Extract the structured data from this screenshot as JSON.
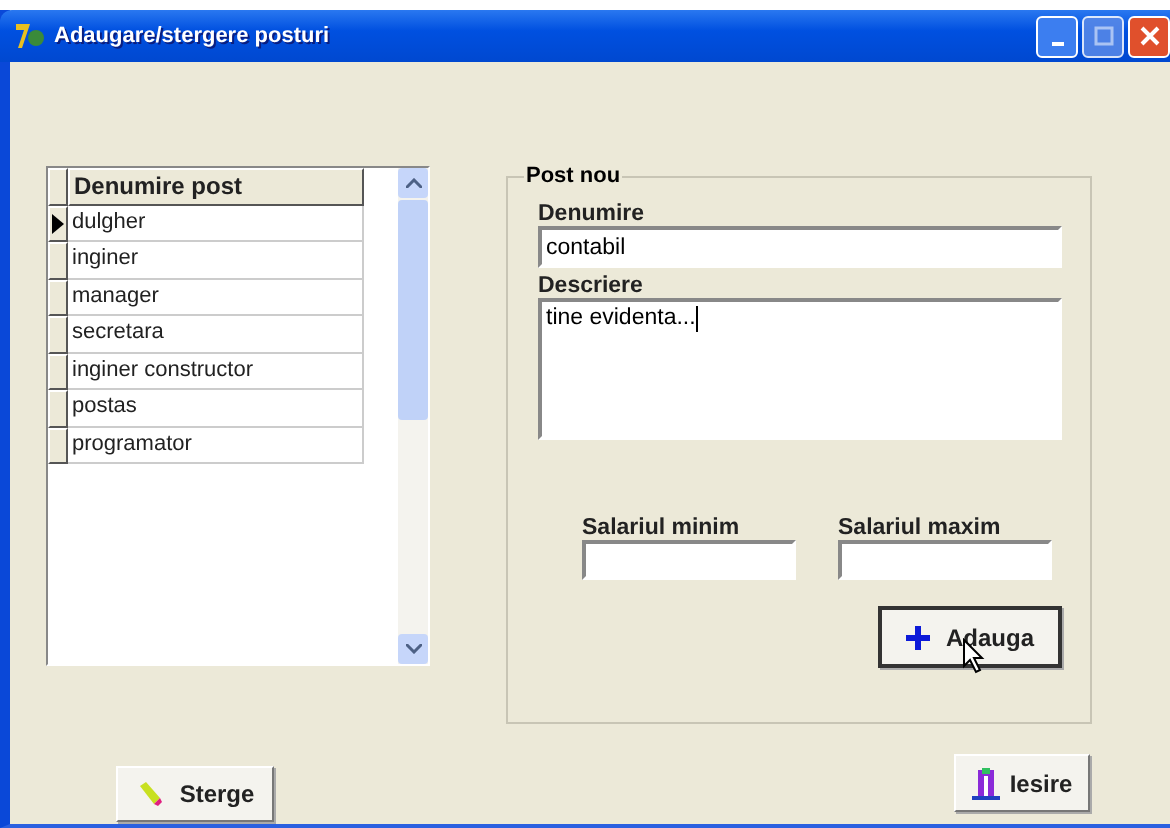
{
  "window": {
    "title": "Adaugare/stergere posturi"
  },
  "grid": {
    "column": "Denumire post",
    "rows": [
      {
        "name": "dulgher",
        "selected": true
      },
      {
        "name": "inginer",
        "selected": false
      },
      {
        "name": "manager",
        "selected": false
      },
      {
        "name": "secretara",
        "selected": false
      },
      {
        "name": "inginer constructor",
        "selected": false
      },
      {
        "name": "postas",
        "selected": false
      },
      {
        "name": "programator",
        "selected": false
      }
    ]
  },
  "group": {
    "title": "Post nou",
    "name_label": "Denumire",
    "name_value": "contabil",
    "desc_label": "Descriere",
    "desc_value": "tine evidenta...",
    "min_label": "Salariul minim",
    "max_label": "Salariul maxim",
    "add_button": "Adauga"
  },
  "buttons": {
    "delete": "Sterge",
    "exit": "Iesire"
  }
}
